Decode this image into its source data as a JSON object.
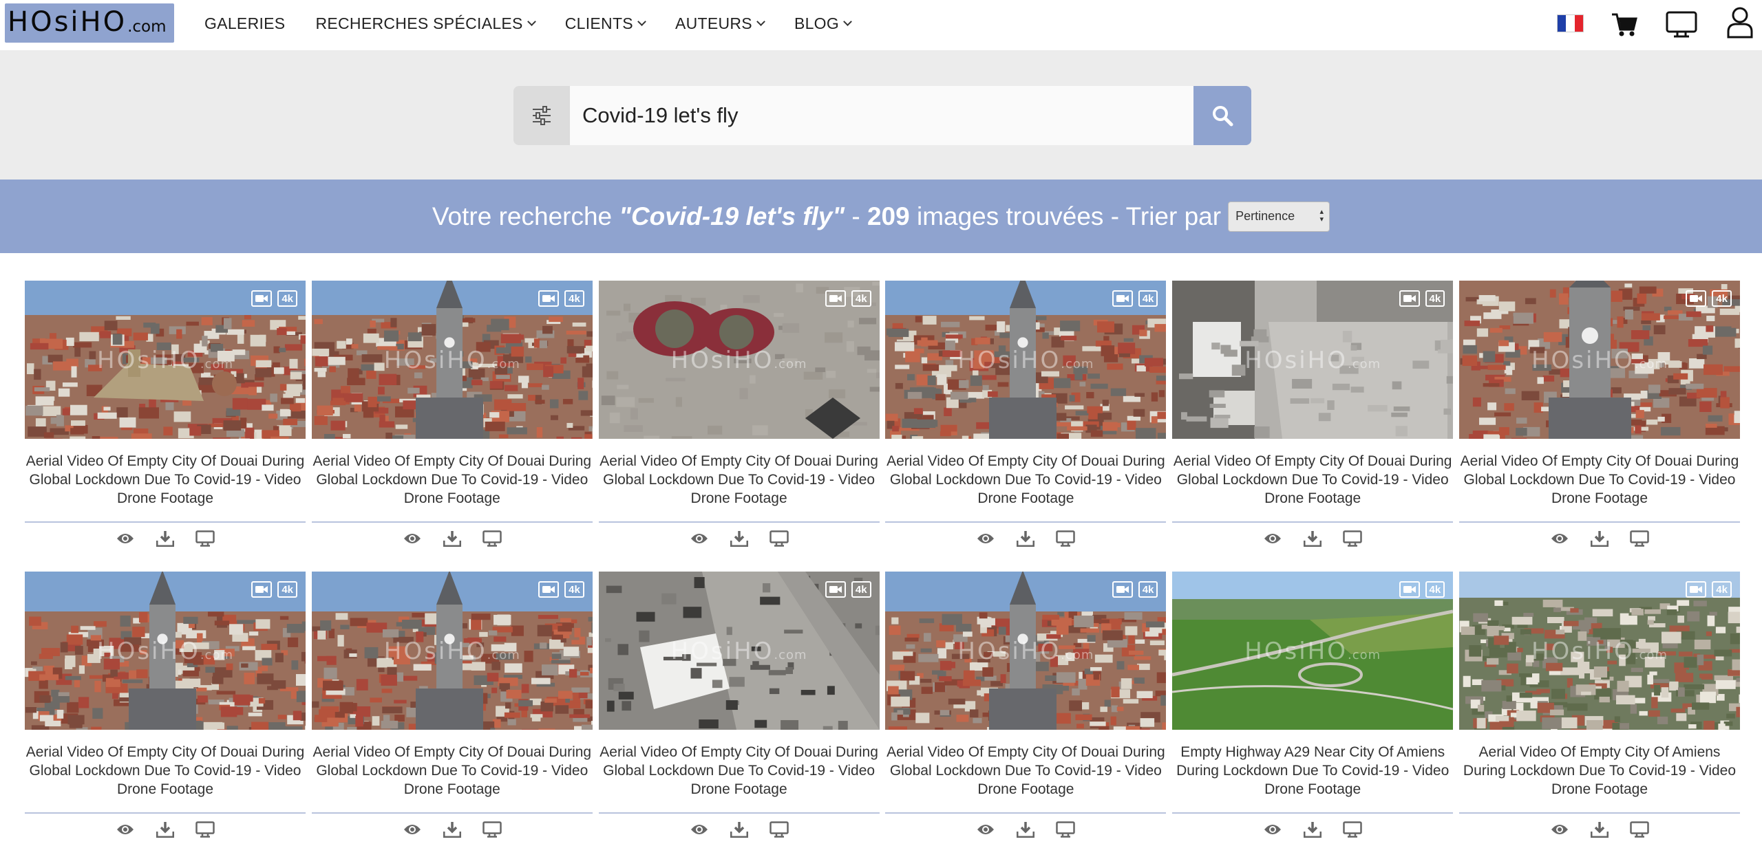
{
  "logo": {
    "big": "HOsiHO",
    "small": ".com"
  },
  "nav": {
    "items": [
      {
        "label": "GALERIES",
        "dropdown": false
      },
      {
        "label": "RECHERCHES SPÉCIALES",
        "dropdown": true
      },
      {
        "label": "CLIENTS",
        "dropdown": true
      },
      {
        "label": "AUTEURS",
        "dropdown": true
      },
      {
        "label": "BLOG",
        "dropdown": true
      }
    ],
    "icons": [
      "flag-fr-icon",
      "cart-icon",
      "monitor-icon",
      "user-icon"
    ]
  },
  "search": {
    "value": "Covid-19 let's fly",
    "filter_icon": "sliders-icon",
    "button_icon": "search-icon"
  },
  "results": {
    "prefix": "Votre recherche",
    "query": "\"Covid-19 let's fly\"",
    "dash1": " - ",
    "count": "209",
    "suffix": " images trouvées - Trier par",
    "sort_value": "Pertinence"
  },
  "colors": {
    "accent": "#8fa3cf",
    "search_band": "#ececec"
  },
  "badges": {
    "video": "video-camera-icon",
    "resolution": "4k"
  },
  "watermark": {
    "big": "HOsiHO",
    "small": ".com"
  },
  "cards": [
    {
      "title": "Aerial Video Of Empty City Of Douai During Global Lockdown Due To Covid-19 - Video Drone Footage",
      "scene": "city-wide"
    },
    {
      "title": "Aerial Video Of Empty City Of Douai During Global Lockdown Due To Covid-19 - Video Drone Footage",
      "scene": "tower"
    },
    {
      "title": "Aerial Video Of Empty City Of Douai During Global Lockdown Due To Covid-19 - Video Drone Footage",
      "scene": "square"
    },
    {
      "title": "Aerial Video Of Empty City Of Douai During Global Lockdown Due To Covid-19 - Video Drone Footage",
      "scene": "tower"
    },
    {
      "title": "Aerial Video Of Empty City Of Douai During Global Lockdown Due To Covid-19 - Video Drone Footage",
      "scene": "plaza"
    },
    {
      "title": "Aerial Video Of Empty City Of Douai During Global Lockdown Due To Covid-19 - Video Drone Footage",
      "scene": "tower-close"
    },
    {
      "title": "Aerial Video Of Empty City Of Douai During Global Lockdown Due To Covid-19 - Video Drone Footage",
      "scene": "tower-sky"
    },
    {
      "title": "Aerial Video Of Empty City Of Douai During Global Lockdown Due To Covid-19 - Video Drone Footage",
      "scene": "tower-sky"
    },
    {
      "title": "Aerial Video Of Empty City Of Douai During Global Lockdown Due To Covid-19 - Video Drone Footage",
      "scene": "street"
    },
    {
      "title": "Aerial Video Of Empty City Of Douai During Global Lockdown Due To Covid-19 - Video Drone Footage",
      "scene": "tower-sky"
    },
    {
      "title": "Empty Highway A29 Near City Of Amiens During Lockdown Due To Covid-19 - Video Drone Footage",
      "scene": "fields"
    },
    {
      "title": "Aerial Video Of Empty City Of Amiens During Lockdown Due To Covid-19 - Video Drone Footage",
      "scene": "suburb"
    }
  ],
  "card_actions": [
    "eye-icon",
    "download-icon",
    "monitor-icon"
  ]
}
